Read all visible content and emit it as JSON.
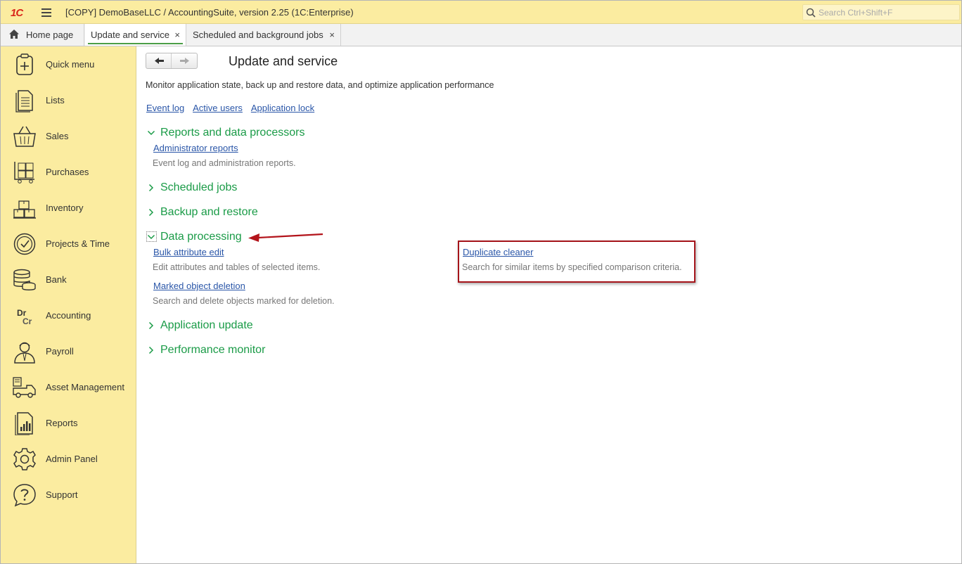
{
  "titlebar": {
    "logo": "1C",
    "title": "[COPY] DemoBaseLLC / AccountingSuite, version 2.25  (1C:Enterprise)",
    "search_placeholder": "Search Ctrl+Shift+F"
  },
  "tabs": {
    "home": "Home page",
    "active": "Update and service",
    "scheduled": "Scheduled and background jobs",
    "close_glyph": "×"
  },
  "sidebar": {
    "items": [
      {
        "label": "Quick menu",
        "icon": "quick-menu-icon"
      },
      {
        "label": "Lists",
        "icon": "lists-icon"
      },
      {
        "label": "Sales",
        "icon": "basket-icon"
      },
      {
        "label": "Purchases",
        "icon": "cart-icon"
      },
      {
        "label": "Inventory",
        "icon": "boxes-icon"
      },
      {
        "label": "Projects & Time",
        "icon": "clock-icon"
      },
      {
        "label": "Bank",
        "icon": "coins-icon"
      },
      {
        "label": "Accounting",
        "icon": "dr-cr-icon"
      },
      {
        "label": "Payroll",
        "icon": "person-icon"
      },
      {
        "label": "Asset Management",
        "icon": "truck-icon"
      },
      {
        "label": "Reports",
        "icon": "report-icon"
      },
      {
        "label": "Admin Panel",
        "icon": "gear-icon"
      },
      {
        "label": "Support",
        "icon": "help-icon"
      }
    ]
  },
  "main": {
    "title": "Update and service",
    "description": "Monitor application state, back up and restore data, and optimize application performance",
    "links": [
      "Event log",
      "Active users",
      "Application lock"
    ],
    "sections": {
      "reports": {
        "title": "Reports and data processors",
        "link": "Administrator reports",
        "desc": "Event log and administration reports."
      },
      "scheduled": {
        "title": "Scheduled jobs"
      },
      "backup": {
        "title": "Backup and restore"
      },
      "data_processing": {
        "title": "Data processing",
        "bulk_link": "Bulk attribute edit",
        "bulk_desc": "Edit attributes and tables of selected items.",
        "marked_link": "Marked object deletion",
        "marked_desc": "Search and delete objects marked for deletion.",
        "dup_link": "Duplicate cleaner",
        "dup_desc": "Search for similar items by specified comparison criteria."
      },
      "app_update": {
        "title": "Application update"
      },
      "perf": {
        "title": "Performance monitor"
      }
    }
  },
  "colors": {
    "accent_yellow": "#fbeca0",
    "section_green": "#1a9b47",
    "link_blue": "#2a56a8",
    "highlight_red": "#a5141a"
  }
}
